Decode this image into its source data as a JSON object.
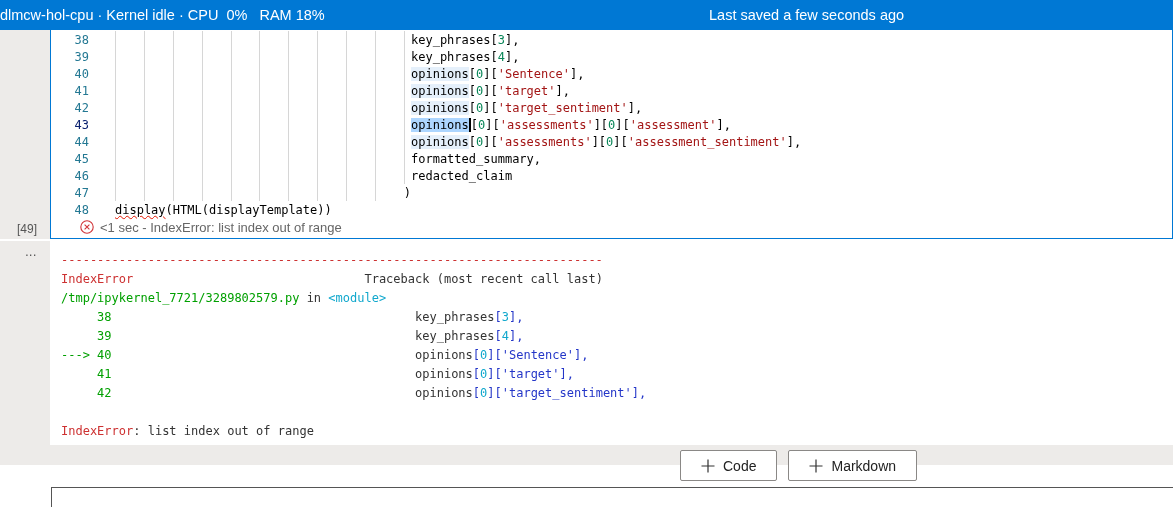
{
  "header": {
    "kernel_status": "dlmcw-hol-cpu · Kernel idle · CPU  0%   RAM 18%",
    "save_status": "Last saved a few seconds ago"
  },
  "cell": {
    "lines": [
      {
        "number": "38",
        "active": false,
        "kind": "argument",
        "tokens": [
          {
            "kind": "plain",
            "text": "key_phrases["
          },
          {
            "kind": "num",
            "text": "3"
          },
          {
            "kind": "plain",
            "text": "],"
          }
        ]
      },
      {
        "number": "39",
        "active": false,
        "kind": "argument",
        "tokens": [
          {
            "kind": "plain",
            "text": "key_phrases["
          },
          {
            "kind": "num",
            "text": "4"
          },
          {
            "kind": "plain",
            "text": "],"
          }
        ]
      },
      {
        "number": "40",
        "active": false,
        "kind": "argument",
        "tokens": [
          {
            "kind": "match",
            "text": "opinions"
          },
          {
            "kind": "plain",
            "text": "["
          },
          {
            "kind": "num",
            "text": "0"
          },
          {
            "kind": "plain",
            "text": "]["
          },
          {
            "kind": "str",
            "text": "'Sentence'"
          },
          {
            "kind": "plain",
            "text": "],"
          }
        ]
      },
      {
        "number": "41",
        "active": false,
        "kind": "argument",
        "tokens": [
          {
            "kind": "match",
            "text": "opinions"
          },
          {
            "kind": "plain",
            "text": "["
          },
          {
            "kind": "num",
            "text": "0"
          },
          {
            "kind": "plain",
            "text": "]["
          },
          {
            "kind": "str",
            "text": "'target'"
          },
          {
            "kind": "plain",
            "text": "],"
          }
        ]
      },
      {
        "number": "42",
        "active": false,
        "kind": "argument",
        "tokens": [
          {
            "kind": "match",
            "text": "opinions"
          },
          {
            "kind": "plain",
            "text": "["
          },
          {
            "kind": "num",
            "text": "0"
          },
          {
            "kind": "plain",
            "text": "]["
          },
          {
            "kind": "str",
            "text": "'target_sentiment'"
          },
          {
            "kind": "plain",
            "text": "],"
          }
        ]
      },
      {
        "number": "43",
        "active": true,
        "kind": "argument",
        "tokens": [
          {
            "kind": "selected",
            "text": "opinions"
          },
          {
            "kind": "plain",
            "text": "["
          },
          {
            "kind": "num",
            "text": "0"
          },
          {
            "kind": "plain",
            "text": "]["
          },
          {
            "kind": "str",
            "text": "'assessments'"
          },
          {
            "kind": "plain",
            "text": "]["
          },
          {
            "kind": "num",
            "text": "0"
          },
          {
            "kind": "plain",
            "text": "]["
          },
          {
            "kind": "str",
            "text": "'assessment'"
          },
          {
            "kind": "plain",
            "text": "],"
          }
        ]
      },
      {
        "number": "44",
        "active": false,
        "kind": "argument",
        "tokens": [
          {
            "kind": "match",
            "text": "opinions"
          },
          {
            "kind": "plain",
            "text": "["
          },
          {
            "kind": "num",
            "text": "0"
          },
          {
            "kind": "plain",
            "text": "]["
          },
          {
            "kind": "str",
            "text": "'assessments'"
          },
          {
            "kind": "plain",
            "text": "]["
          },
          {
            "kind": "num",
            "text": "0"
          },
          {
            "kind": "plain",
            "text": "]["
          },
          {
            "kind": "str",
            "text": "'assessment_sentiment'"
          },
          {
            "kind": "plain",
            "text": "],"
          }
        ]
      },
      {
        "number": "45",
        "active": false,
        "kind": "argument",
        "tokens": [
          {
            "kind": "plain",
            "text": "formatted_summary,"
          }
        ]
      },
      {
        "number": "46",
        "active": false,
        "kind": "argument",
        "tokens": [
          {
            "kind": "plain",
            "text": "redacted_claim"
          }
        ]
      },
      {
        "number": "47",
        "active": false,
        "kind": "closing",
        "tokens": [
          {
            "kind": "plain",
            "text": ")"
          }
        ]
      },
      {
        "number": "48",
        "active": false,
        "kind": "statement",
        "tokens": [
          {
            "kind": "warn",
            "text": "display"
          },
          {
            "kind": "plain",
            "text": "(HTML(displayTemplate))"
          }
        ]
      }
    ],
    "execution_count": "[49]",
    "status": {
      "kind": "error",
      "text": "<1 sec - IndexError: list index out of range"
    }
  },
  "output": {
    "prompt": "...",
    "lines": [
      [
        {
          "kind": "err",
          "text": "---------------------------------------------------------------------------"
        }
      ],
      [
        {
          "kind": "err",
          "text": "IndexError"
        },
        {
          "kind": "plain",
          "text": "                                Traceback (most recent call last)"
        }
      ],
      [
        {
          "kind": "path",
          "text": "/tmp/ipykernel_7721/3289802579.py"
        },
        {
          "kind": "plain",
          "text": " in "
        },
        {
          "kind": "module",
          "text": "<module>"
        }
      ],
      [
        {
          "kind": "path",
          "text": "     38"
        },
        {
          "kind": "plain",
          "text": "                                          key_phrases"
        },
        {
          "kind": "punct",
          "text": "["
        },
        {
          "kind": "num",
          "text": "3"
        },
        {
          "kind": "punct",
          "text": "],"
        }
      ],
      [
        {
          "kind": "path",
          "text": "     39"
        },
        {
          "kind": "plain",
          "text": "                                          key_phrases"
        },
        {
          "kind": "punct",
          "text": "["
        },
        {
          "kind": "num",
          "text": "4"
        },
        {
          "kind": "punct",
          "text": "],"
        }
      ],
      [
        {
          "kind": "path",
          "text": "---> 40"
        },
        {
          "kind": "plain",
          "text": "                                          opinions"
        },
        {
          "kind": "punct",
          "text": "["
        },
        {
          "kind": "num",
          "text": "0"
        },
        {
          "kind": "punct",
          "text": "]['Sentence'],"
        }
      ],
      [
        {
          "kind": "path",
          "text": "     41"
        },
        {
          "kind": "plain",
          "text": "                                          opinions"
        },
        {
          "kind": "punct",
          "text": "["
        },
        {
          "kind": "num",
          "text": "0"
        },
        {
          "kind": "punct",
          "text": "]['target'],"
        }
      ],
      [
        {
          "kind": "path",
          "text": "     42"
        },
        {
          "kind": "plain",
          "text": "                                          opinions"
        },
        {
          "kind": "punct",
          "text": "["
        },
        {
          "kind": "num",
          "text": "0"
        },
        {
          "kind": "punct",
          "text": "]['target_sentiment'],"
        }
      ]
    ],
    "summary": [
      {
        "kind": "err",
        "text": "IndexError"
      },
      {
        "kind": "plain",
        "text": ": list index out of range"
      }
    ]
  },
  "add_buttons": [
    {
      "label": "Code"
    },
    {
      "label": "Markdown"
    }
  ]
}
